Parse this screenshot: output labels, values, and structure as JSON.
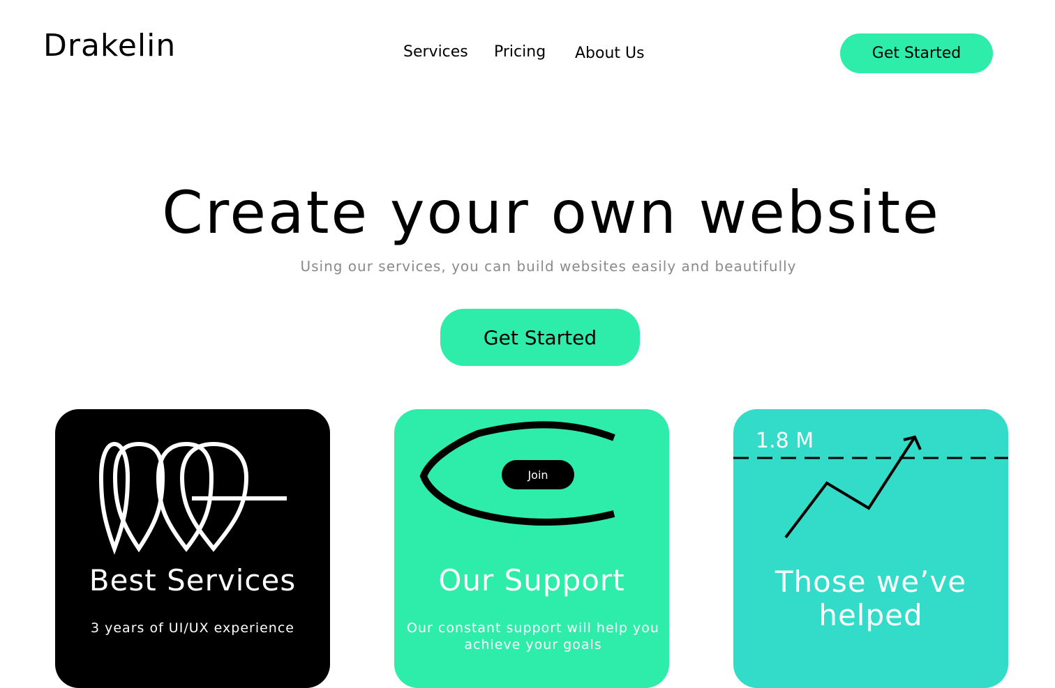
{
  "brand": {
    "name": "Drakelin"
  },
  "nav": {
    "items": [
      "Services",
      "Pricing",
      "About Us"
    ]
  },
  "header": {
    "cta_label": "Get Started"
  },
  "hero": {
    "title": "Create your own website",
    "subtitle": "Using our services, you can build websites easily and beautifully",
    "cta_label": "Get Started"
  },
  "cards": [
    {
      "title": "Best Services",
      "text": "3 years of UI/UX experience",
      "color": "#000000"
    },
    {
      "title": "Our Support",
      "text": "Our constant support will help you achieve your goals",
      "pill_label": "Join",
      "color": "#2eecaa"
    },
    {
      "title": "Those we’ve helped",
      "stat": "1.8 M",
      "color": "#33dcc9"
    }
  ],
  "colors": {
    "accent": "#2eecaa",
    "teal": "#33dcc9",
    "muted_text": "#8a8a8a"
  }
}
